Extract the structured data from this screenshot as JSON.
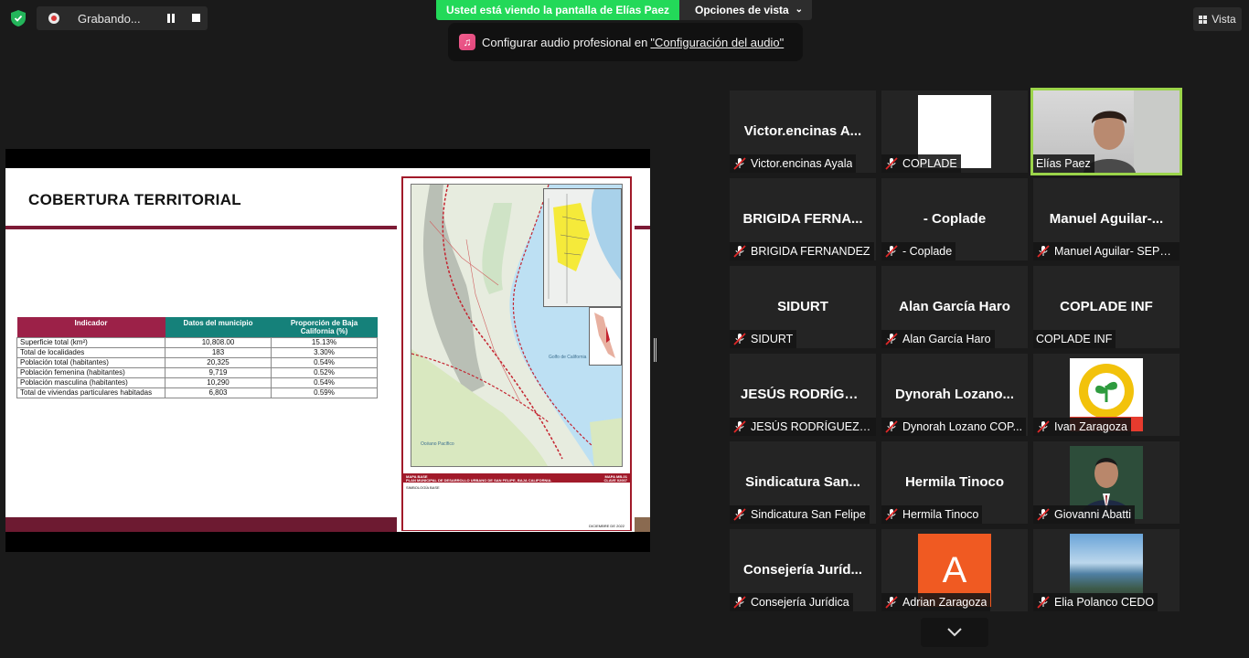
{
  "recording": {
    "label": "Grabando..."
  },
  "sharing_banner": "Usted está viendo la pantalla de Elías Paez",
  "view_options": "Opciones de vista",
  "audio_prompt": {
    "text": "Configurar audio profesional en",
    "link": "\"Configuración del audio\""
  },
  "view_button": "Vista",
  "slide": {
    "title": "COBERTURA TERRITORIAL",
    "table": {
      "headers": [
        "Indicador",
        "Datos del municipio",
        "Proporción de Baja California (%)"
      ],
      "rows": [
        [
          "Superficie total (km²)",
          "10,808.00",
          "15.13%"
        ],
        [
          "Total de localidades",
          "183",
          "3.30%"
        ],
        [
          "Población total (habitantes)",
          "20,325",
          "0.54%"
        ],
        [
          "Población femenina (habitantes)",
          "9,719",
          "0.52%"
        ],
        [
          "Población masculina (habitantes)",
          "10,290",
          "0.54%"
        ],
        [
          "Total de viviendas particulares habitadas",
          "6,803",
          "0.59%"
        ]
      ]
    },
    "map": {
      "footer_left": "MAPA BASE",
      "footer_right": "MAPA MB-01",
      "footer_title": "PLAN MUNICIPAL DE DESARROLLO URBANO DE SAN FELIPE, BAJA CALIFORNIA.",
      "footer_code": "CLAVE 02007",
      "legend_title": "SIMBOLOGÍA BASE",
      "gulf_label": "Golfo de California",
      "ocean_label": "Océano Pacífico",
      "date": "DICIEMBRE DE 2022"
    }
  },
  "participants": [
    {
      "big": "Victor.encinas  A...",
      "label": "Victor.encinas Ayala",
      "muted": true
    },
    {
      "big": "",
      "label": "COPLADE",
      "muted": true,
      "thumb": "white"
    },
    {
      "big": "",
      "label": "Elías Paez",
      "muted": false,
      "thumb": "video",
      "active": true
    },
    {
      "big": "BRIGIDA FERNA...",
      "label": "BRIGIDA FERNANDEZ",
      "muted": true
    },
    {
      "big": "- Coplade",
      "label": "- Coplade",
      "muted": true
    },
    {
      "big": "Manuel  Aguilar-...",
      "label": "Manuel Aguilar- SEPE...",
      "muted": true
    },
    {
      "big": "SIDURT",
      "label": "SIDURT",
      "muted": true
    },
    {
      "big": "Alan García Haro",
      "label": "Alan García Haro",
      "muted": true
    },
    {
      "big": "COPLADE INF",
      "label": "COPLADE INF",
      "muted": false
    },
    {
      "big": "JESÚS  RODRÍGU...",
      "label": "JESÚS RODRÍGUEZ C...",
      "muted": true
    },
    {
      "big": "Dynorah  Lozano...",
      "label": "Dynorah Lozano COP...",
      "muted": true
    },
    {
      "big": "",
      "label": "Ivan Zaragoza",
      "muted": true,
      "thumb": "logo"
    },
    {
      "big": "Sindicatura  San...",
      "label": "Sindicatura San Felipe",
      "muted": true
    },
    {
      "big": "Hermila Tinoco",
      "label": "Hermila Tinoco",
      "muted": true
    },
    {
      "big": "",
      "label": "Giovanni Abatti",
      "muted": true,
      "thumb": "portrait"
    },
    {
      "big": "Consejería  Juríd...",
      "label": "Consejería Jurídica",
      "muted": true
    },
    {
      "big": "",
      "label": "Adrian Zaragoza",
      "muted": true,
      "thumb": "letter",
      "letter": "A"
    },
    {
      "big": "",
      "label": "Elia Polanco CEDO",
      "muted": true,
      "thumb": "sea"
    }
  ],
  "colors": {
    "banner_green": "#23d959",
    "active_border": "#9bd44a",
    "letter_avatar": "#f05a22"
  }
}
